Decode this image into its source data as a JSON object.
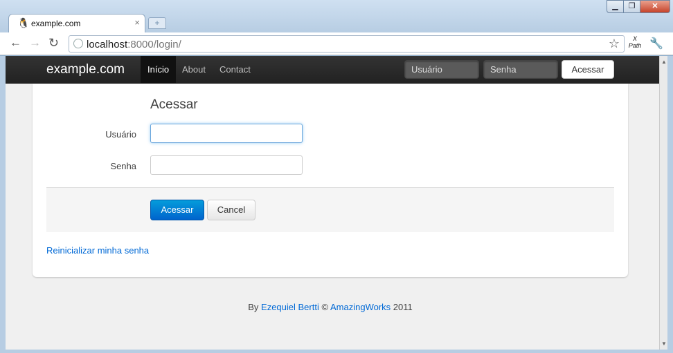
{
  "browser": {
    "tab_title": "example.com",
    "tab_close": "×",
    "new_tab": "+",
    "url_host": "localhost",
    "url_rest": ":8000/login/",
    "xpath_line1": "X",
    "xpath_line2": "Path",
    "window_min": "▁",
    "window_max": "❐",
    "window_close": "✕"
  },
  "navbar": {
    "brand": "example.com",
    "links": [
      {
        "label": "Início",
        "active": true
      },
      {
        "label": "About",
        "active": false
      },
      {
        "label": "Contact",
        "active": false
      }
    ],
    "user_placeholder": "Usuário",
    "pass_placeholder": "Senha",
    "login_button": "Acessar"
  },
  "form": {
    "legend": "Acessar",
    "user_label": "Usuário",
    "user_value": "",
    "pass_label": "Senha",
    "pass_value": "",
    "submit": "Acessar",
    "cancel": "Cancel",
    "reset_link": "Reinicializar minha senha"
  },
  "footer": {
    "by": "By",
    "author": "Ezequiel Bertti",
    "copy": "©",
    "company": "AmazingWorks",
    "year": "2011"
  },
  "icons": {
    "tab": "tux-icon",
    "back": "back-arrow-icon",
    "forward": "forward-arrow-icon",
    "reload": "reload-icon",
    "site": "globe-icon",
    "bookmark": "star-icon",
    "tools": "wrench-icon"
  },
  "colors": {
    "link": "#0069d6",
    "primary": "#0064cd",
    "topbar": "#222222"
  }
}
